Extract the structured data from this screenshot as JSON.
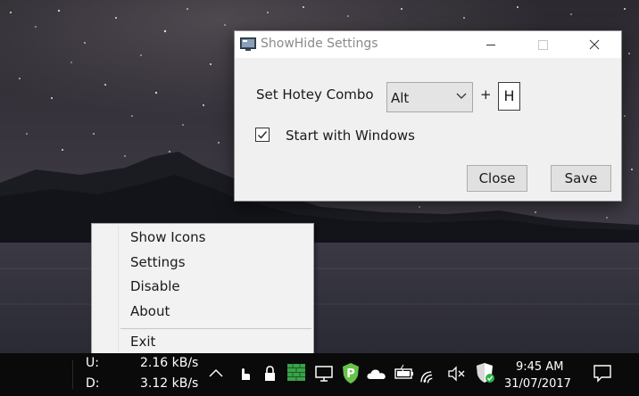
{
  "settings_window": {
    "title": "ShowHide Settings",
    "hotkey_label": "Set Hotey Combo",
    "modifier_value": "Alt",
    "plus": "+",
    "key_value": "H",
    "startup_label": "Start with Windows",
    "startup_checked": true,
    "close_label": "Close",
    "save_label": "Save"
  },
  "context_menu": {
    "items": [
      "Show Icons",
      "Settings",
      "Disable",
      "About"
    ],
    "exit_label": "Exit"
  },
  "taskbar": {
    "upload_label": "U:",
    "upload_value": "2.16 kB/s",
    "download_label": "D:",
    "download_value": "3.12 kB/s",
    "tray_icons": [
      "chevron-up-icon",
      "touch-hand-icon",
      "lock-icon",
      "brick-icon",
      "monitor-icon",
      "p-shield-icon",
      "onedrive-cloud-icon",
      "battery-icon",
      "wifi-icon",
      "muted-speaker-icon",
      "defender-shield-icon"
    ],
    "time": "9:45 AM",
    "date": "31/07/2017",
    "notification_icon": "action-center-icon"
  }
}
